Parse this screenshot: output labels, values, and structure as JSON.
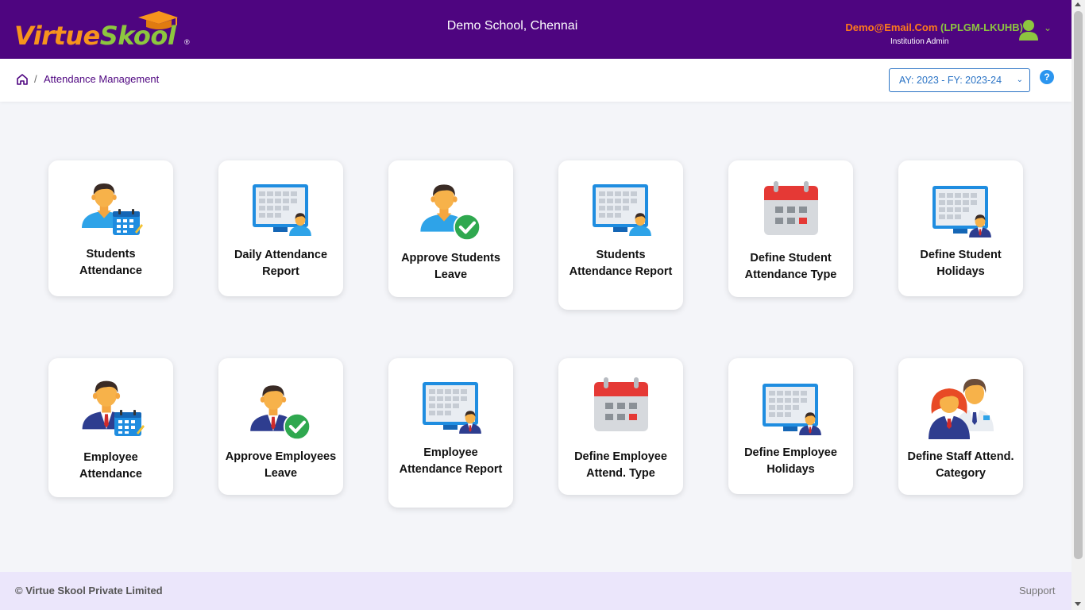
{
  "header": {
    "logo_part1": "Virtue",
    "logo_part2": "Skool",
    "logo_reg": "®",
    "school_name": "Demo School, Chennai",
    "user_email": "Demo@Email.Com",
    "user_code": "(LPLGM-LKUHB)",
    "user_role": "Institution Admin",
    "brand_color": "#4e0580"
  },
  "breadcrumb": {
    "separator": "/",
    "current": "Attendance Management"
  },
  "academic_year": {
    "selected": "AY: 2023 - FY: 2023-24"
  },
  "help_label": "?",
  "cards": [
    {
      "label": "Students Attendance",
      "icon": "student-calendar-icon"
    },
    {
      "label": "Daily Attendance Report",
      "icon": "monitor-report-icon"
    },
    {
      "label": "Approve Students Leave",
      "icon": "student-approve-icon"
    },
    {
      "label": "Students Attendance Report",
      "icon": "monitor-report-icon"
    },
    {
      "label": "Define Student Attendance Type",
      "icon": "calendar-icon"
    },
    {
      "label": "Define Student Holidays",
      "icon": "monitor-holidays-icon"
    },
    {
      "label": "Employee Attendance",
      "icon": "employee-calendar-icon"
    },
    {
      "label": "Approve Employees Leave",
      "icon": "employee-approve-icon"
    },
    {
      "label": "Employee Attendance Report",
      "icon": "monitor-report-icon"
    },
    {
      "label": "Define Employee Attend. Type",
      "icon": "calendar-icon"
    },
    {
      "label": "Define Employee Holidays",
      "icon": "monitor-holidays-icon"
    },
    {
      "label": "Define Staff Attend. Category",
      "icon": "staff-group-icon"
    }
  ],
  "footer": {
    "copyright": "© Virtue Skool Private Limited",
    "support": "Support"
  }
}
